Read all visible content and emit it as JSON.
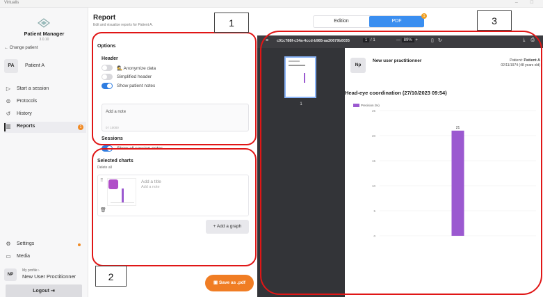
{
  "window": {
    "app_title": "Virtualis",
    "controls": "– □"
  },
  "sidebar": {
    "app_name": "Patient Manager",
    "version": "3.0.10",
    "change_patient": "← Change patient",
    "patient_initials": "PA",
    "patient_name": "Patient A",
    "items": [
      {
        "label": "Start a session",
        "icon": "play-icon"
      },
      {
        "label": "Protocols",
        "icon": "protocols-icon"
      },
      {
        "label": "History",
        "icon": "history-icon"
      },
      {
        "label": "Reports",
        "icon": "reports-icon",
        "badge": "1"
      }
    ],
    "settings_label": "Settings",
    "media_label": "Media",
    "profile_small": "My profile ›",
    "profile_initials": "NP",
    "profile_name": "New User Proctitionner",
    "logout_label": "Logout"
  },
  "report": {
    "title": "Report",
    "subtitle": "Edit and visualize reports for Patient A.",
    "options_heading": "Options",
    "header_heading": "Header",
    "toggles": [
      {
        "label": "Anonymize data",
        "on": false
      },
      {
        "label": "Simplified header",
        "on": false
      },
      {
        "label": "Show patient notes",
        "on": true
      }
    ],
    "note_placeholder": "Add a note",
    "note_counter": "0 / 10000",
    "sessions_heading": "Sessions",
    "sessions_toggle_label": "Show all session notes",
    "selected_charts_heading": "Selected charts",
    "delete_all": "Delete all",
    "card_title_placeholder": "Add a title",
    "card_note_placeholder": "Add a note",
    "add_graph_label": "Add a graph",
    "save_label": "Save as .pdf"
  },
  "view_switch": {
    "edition_label": "Edition",
    "pdf_label": "PDF",
    "badge": "1"
  },
  "pdf_toolbar": {
    "filename": "c01c788f-c34a-4ccd-b985-aa20679b0035",
    "page_current": "1",
    "page_total": "/ 1",
    "zoom": "89%",
    "thumb_page_number": "1"
  },
  "pdf": {
    "initials": "Np",
    "user": "New user practitionner",
    "patient_label": "Patient:",
    "patient_name": "Patient A",
    "dob": "02/11/1974 (48 years old)",
    "heading": "Head-eye coordination (27/10/2023 09:54)"
  },
  "chart_data": {
    "type": "bar",
    "categories": [
      ""
    ],
    "series": [
      {
        "name": "Precision (%)",
        "values": [
          21
        ]
      }
    ],
    "ylim": [
      0,
      25
    ],
    "yticks": [
      0,
      5,
      10,
      15,
      20,
      25
    ],
    "color": "#9b59d0",
    "grid": true,
    "legend": "top-left"
  },
  "annotations": [
    {
      "label": "1"
    },
    {
      "label": "2"
    },
    {
      "label": "3"
    }
  ]
}
